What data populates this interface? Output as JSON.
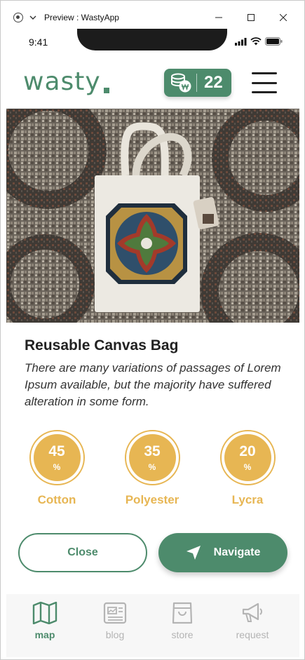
{
  "window": {
    "title": "Preview : WastyApp"
  },
  "status_bar": {
    "time": "9:41"
  },
  "header": {
    "logo": "wasty",
    "coins": "22"
  },
  "product": {
    "title": "Reusable Canvas Bag",
    "description": "There are many variations of passages of Lorem Ipsum available, but the majority have suffered alteration in some form."
  },
  "materials": [
    {
      "percent": "45",
      "unit": "%",
      "name": "Cotton"
    },
    {
      "percent": "35",
      "unit": "%",
      "name": "Polyester"
    },
    {
      "percent": "20",
      "unit": "%",
      "name": "Lycra"
    }
  ],
  "actions": {
    "close_label": "Close",
    "navigate_label": "Navigate"
  },
  "tabs": [
    {
      "label": "map",
      "active": true,
      "icon": "map-icon"
    },
    {
      "label": "blog",
      "active": false,
      "icon": "news-icon"
    },
    {
      "label": "store",
      "active": false,
      "icon": "shopping-bag-icon"
    },
    {
      "label": "request",
      "active": false,
      "icon": "megaphone-icon"
    }
  ],
  "colors": {
    "brand_green": "#4d8b6c",
    "accent_gold": "#e7b653",
    "inactive_gray": "#b4b4b4"
  }
}
